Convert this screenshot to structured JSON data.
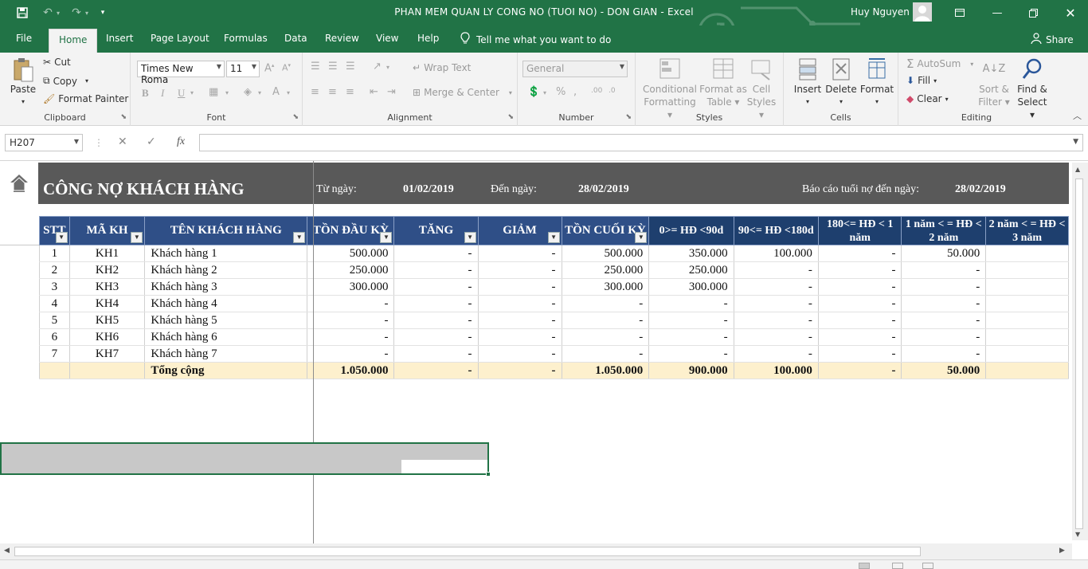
{
  "window": {
    "title": "PHAN MEM QUAN LY CONG NO (TUOI NO) - DON GIAN  -  Excel",
    "user": "Huy Nguyen"
  },
  "tabs": [
    "File",
    "Home",
    "Insert",
    "Page Layout",
    "Formulas",
    "Data",
    "Review",
    "View",
    "Help"
  ],
  "tell_me": "Tell me what you want to do",
  "share": "Share",
  "ribbon": {
    "clipboard": {
      "paste": "Paste",
      "cut": "Cut",
      "copy": "Copy",
      "format_painter": "Format Painter",
      "label": "Clipboard"
    },
    "font": {
      "name": "Times New Roma",
      "size": "11",
      "label": "Font"
    },
    "alignment": {
      "wrap": "Wrap Text",
      "merge": "Merge & Center",
      "label": "Alignment"
    },
    "number": {
      "format": "General",
      "label": "Number"
    },
    "styles": {
      "conditional": "Conditional",
      "conditional2": "Formatting",
      "format_table": "Format as",
      "format_table2": "Table",
      "cell_styles": "Cell",
      "cell_styles2": "Styles",
      "label": "Styles"
    },
    "cells": {
      "insert": "Insert",
      "delete": "Delete",
      "format": "Format",
      "label": "Cells"
    },
    "editing": {
      "autosum": "AutoSum",
      "fill": "Fill",
      "clear": "Clear",
      "sort": "Sort &",
      "sort2": "Filter",
      "find": "Find &",
      "find2": "Select",
      "label": "Editing"
    }
  },
  "formula_bar": {
    "name_box": "H207",
    "formula": ""
  },
  "banner": {
    "title": "CÔNG NỢ KHÁCH HÀNG",
    "from_label": "Từ ngày:",
    "from_value": "01/02/2019",
    "to_label": "Đến ngày:",
    "to_value": "28/02/2019",
    "age_label": "Báo cáo tuổi nợ đến ngày:",
    "age_value": "28/02/2019"
  },
  "table": {
    "headers": [
      "STT",
      "MÃ KH",
      "TÊN KHÁCH HÀNG",
      "TỒN ĐẦU KỲ",
      "TĂNG",
      "GIẢM",
      "TỒN CUỐI KỲ",
      "0>= HĐ <90d",
      "90<= HĐ <180d",
      "180<= HĐ < 1 năm",
      "1 năm < = HĐ < 2 năm",
      "2 năm < = HĐ < 3 năm"
    ],
    "rows": [
      [
        "1",
        "KH1",
        "Khách hàng 1",
        "500.000",
        "-",
        "-",
        "500.000",
        "350.000",
        "100.000",
        "-",
        "50.000",
        ""
      ],
      [
        "2",
        "KH2",
        "Khách hàng 2",
        "250.000",
        "-",
        "-",
        "250.000",
        "250.000",
        "-",
        "-",
        "-",
        ""
      ],
      [
        "3",
        "KH3",
        "Khách hàng 3",
        "300.000",
        "-",
        "-",
        "300.000",
        "300.000",
        "-",
        "-",
        "-",
        ""
      ],
      [
        "4",
        "KH4",
        "Khách hàng 4",
        "-",
        "-",
        "-",
        "-",
        "-",
        "-",
        "-",
        "-",
        ""
      ],
      [
        "5",
        "KH5",
        "Khách hàng 5",
        "-",
        "-",
        "-",
        "-",
        "-",
        "-",
        "-",
        "-",
        ""
      ],
      [
        "6",
        "KH6",
        "Khách hàng 6",
        "-",
        "-",
        "-",
        "-",
        "-",
        "-",
        "-",
        "-",
        ""
      ],
      [
        "7",
        "KH7",
        "Khách hàng 7",
        "-",
        "-",
        "-",
        "-",
        "-",
        "-",
        "-",
        "-",
        ""
      ]
    ],
    "total": [
      "",
      "",
      "Tổng cộng",
      "1.050.000",
      "-",
      "-",
      "1.050.000",
      "900.000",
      "100.000",
      "-",
      "50.000",
      ""
    ]
  },
  "colors": {
    "excel_green": "#217346",
    "header_blue": "#2f4f87",
    "banner_gray": "#595959",
    "total_fill": "#fdf0cd"
  }
}
